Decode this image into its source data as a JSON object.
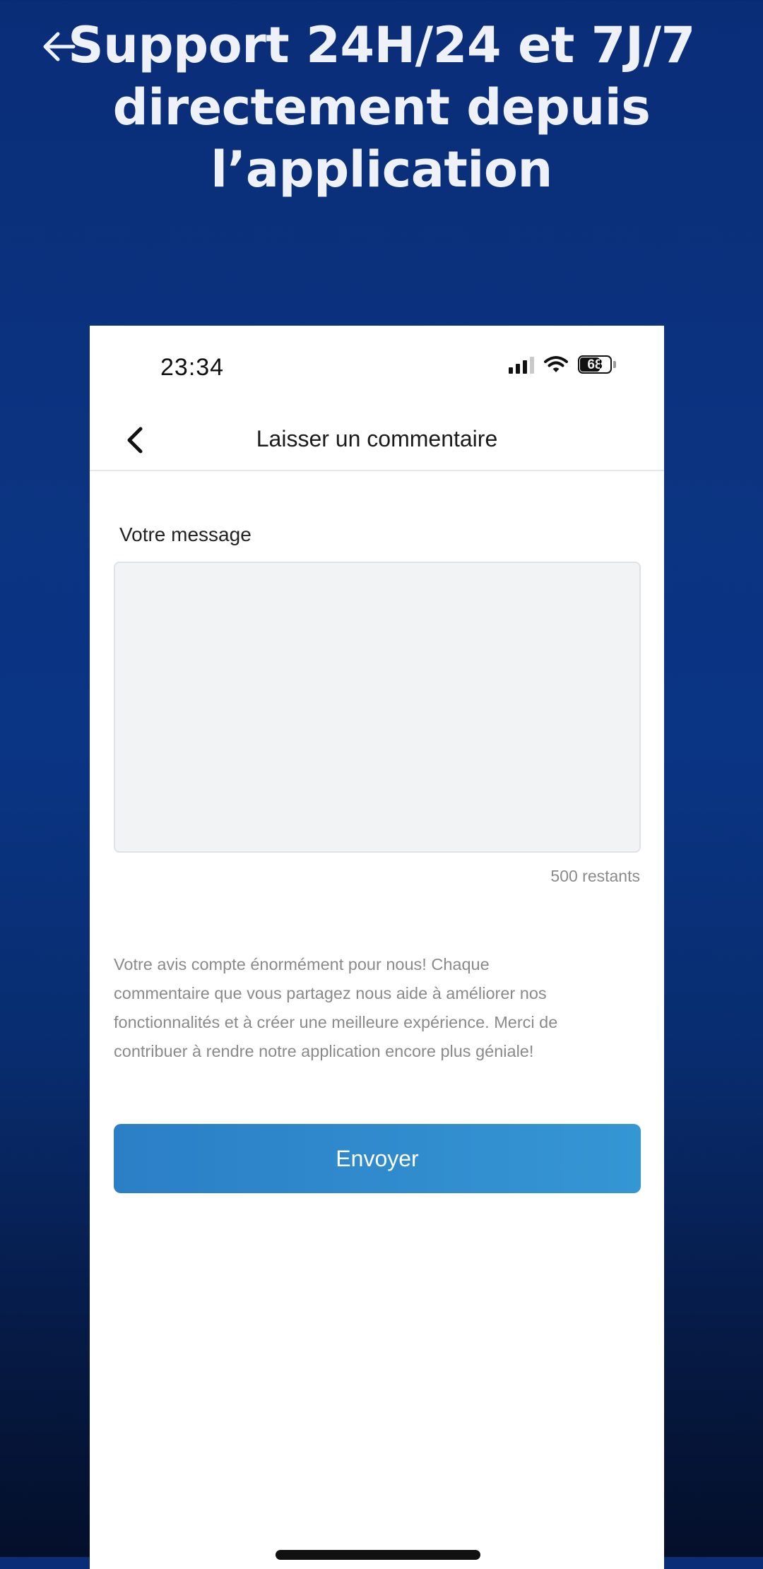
{
  "banner": {
    "back_icon": "arrow-left-icon",
    "headline_lines": [
      "Support 24H/24 et 7J/7",
      "directement depuis",
      "l’application"
    ]
  },
  "status_bar": {
    "time": "23:34",
    "battery_level": 68,
    "battery_label": "68",
    "signal_bars_active": 3,
    "icons": [
      "signal-icon",
      "wifi-icon",
      "battery-icon"
    ]
  },
  "nav": {
    "back_icon": "chevron-left-icon",
    "title": "Laisser un commentaire"
  },
  "form": {
    "message_label": "Votre message",
    "message_value": "",
    "message_placeholder": "",
    "remaining_counter": "500 restants",
    "info_lines": [
      "Votre avis compte énormément pour nous! Chaque",
      "commentaire que vous partagez nous aide à améliorer nos",
      "fonctionnalités et à créer une meilleure expérience. Merci de",
      "contribuer à rendre notre application encore plus géniale!"
    ],
    "submit_label": "Envoyer"
  },
  "colors": {
    "banner_bg_top": "#0a2d78",
    "banner_bg_bottom": "#040f2a",
    "button_start": "#2b7fc6",
    "button_end": "#3596d4",
    "input_bg": "#f1f3f5",
    "muted_text": "#8a8a8a"
  }
}
